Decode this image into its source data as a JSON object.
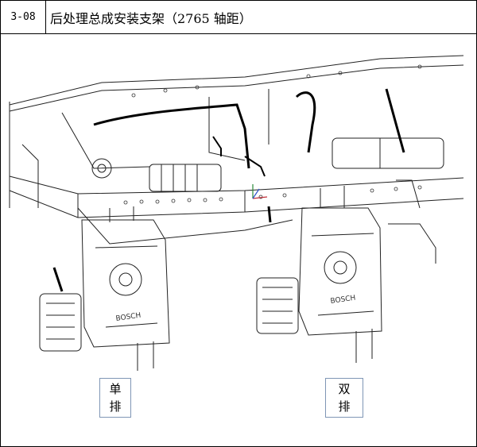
{
  "header": {
    "code": "3-08",
    "title": "后处理总成安装支架（2765 轴距）"
  },
  "drawing": {
    "brand_left": "BOSCH",
    "brand_right": "BOSCH"
  },
  "labels": {
    "single": [
      "单",
      "排"
    ],
    "double": [
      "双",
      "排"
    ]
  }
}
